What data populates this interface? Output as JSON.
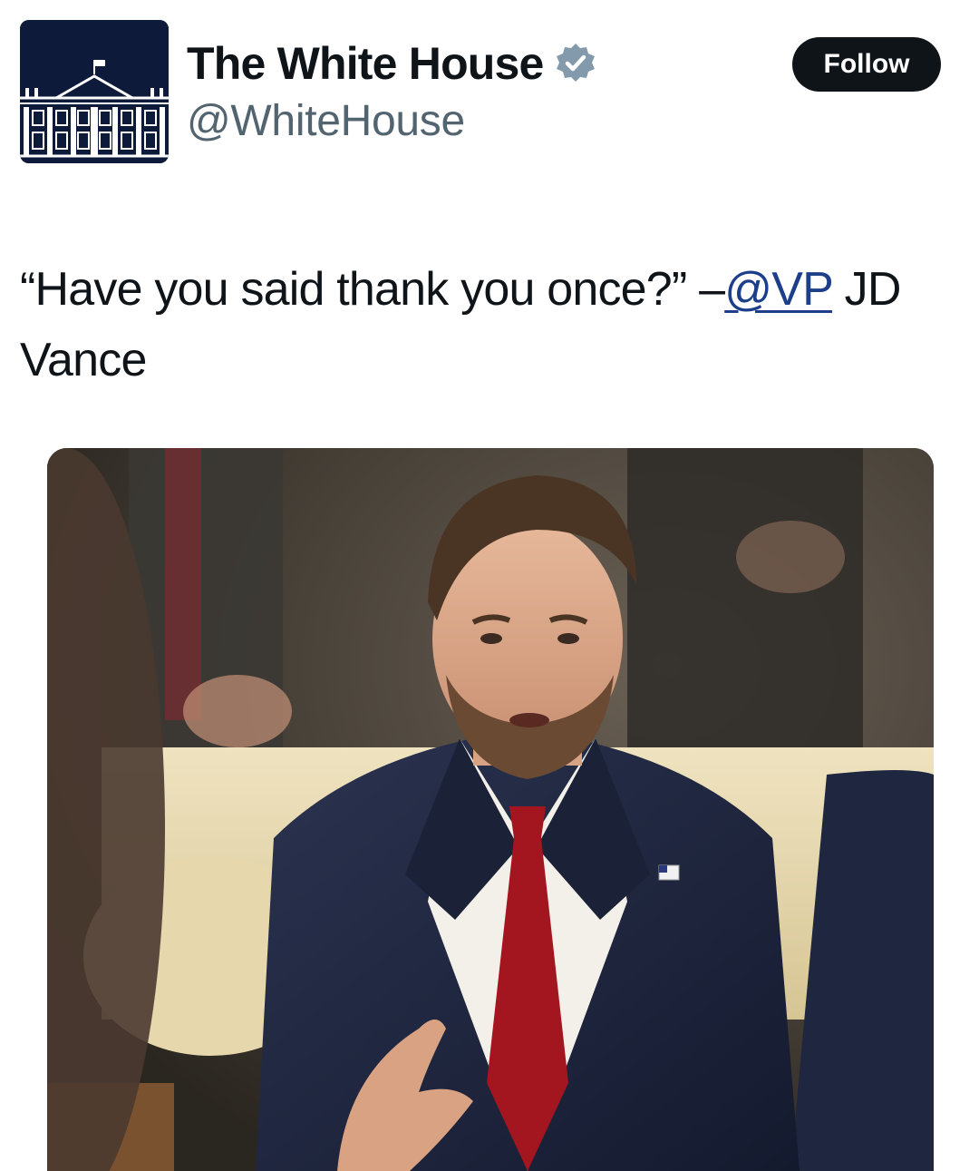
{
  "account": {
    "display_name": "The White House",
    "handle": "@WhiteHouse",
    "verified": true,
    "verified_badge_color": "#829aab"
  },
  "actions": {
    "follow_label": "Follow"
  },
  "tweet": {
    "text_before": "“Have you said thank you once?” –",
    "mention": "@VP",
    "text_after": " JD Vance"
  },
  "media": {
    "content": "photo of a man in a navy suit and red tie gesturing while seated"
  },
  "icons": {
    "avatar": "white-house-building-icon",
    "verified": "verified-badge-icon",
    "flag_pin": "american-flag-pin"
  },
  "colors": {
    "mention_link": "#1d3f8a",
    "follow_button_bg": "#0f1419",
    "avatar_bg": "#0d1a3a"
  }
}
